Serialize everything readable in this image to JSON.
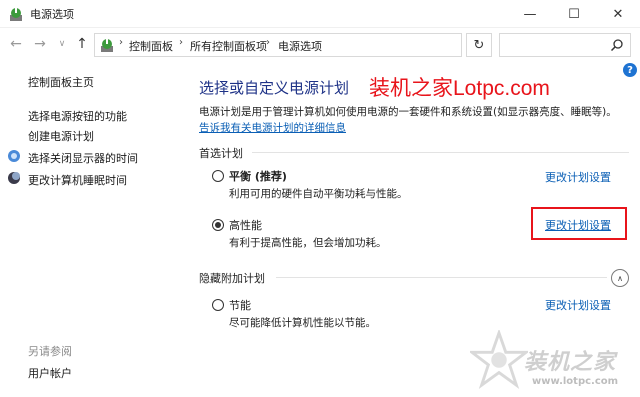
{
  "window": {
    "title": "电源选项",
    "minimize_glyph": "—",
    "maximize_glyph": "☐",
    "close_glyph": "✕"
  },
  "nav": {
    "back_glyph": "←",
    "forward_glyph": "→",
    "recent_glyph": "∨",
    "up_glyph": "↑",
    "refresh_glyph": "↻",
    "breadcrumb": [
      "控制面板",
      "所有控制面板项",
      "电源选项"
    ],
    "sep_glyph": "›",
    "dropdown_glyph": "∨",
    "search_placeholder": ""
  },
  "help": {
    "label": "?"
  },
  "sidebar": {
    "home": "控制面板主页",
    "links": [
      "选择电源按钮的功能",
      "创建电源计划",
      "选择关闭显示器的时间",
      "更改计算机睡眠时间"
    ],
    "see_also_heading": "另请参阅",
    "see_also": [
      "用户帐户"
    ]
  },
  "main": {
    "title": "选择或自定义电源计划",
    "description": "电源计划是用于管理计算机如何使用电源的一套硬件和系统设置(如显示器亮度、睡眠等)。",
    "details_link": "告诉我有关电源计划的详细信息",
    "preferred_section": "首选计划",
    "hidden_section": "隐藏附加计划",
    "plans": [
      {
        "name": "平衡 (推荐)",
        "desc": "利用可用的硬件自动平衡功耗与性能。",
        "link": "更改计划设置",
        "selected": false
      },
      {
        "name": "高性能",
        "desc": "有利于提高性能，但会增加功耗。",
        "link": "更改计划设置",
        "selected": true
      },
      {
        "name": "节能",
        "desc": "尽可能降低计算机性能以节能。",
        "link": "更改计划设置",
        "selected": false
      }
    ],
    "collapse_glyph": "∧"
  },
  "watermark": {
    "top_text": "装机之家Lotpc.com",
    "logo_text": "装机之家",
    "logo_url": "www.lotpc.com"
  },
  "colors": {
    "title_blue": "#1e3287",
    "link_blue": "#0b5fb5",
    "annotation_red": "#e8141b"
  }
}
